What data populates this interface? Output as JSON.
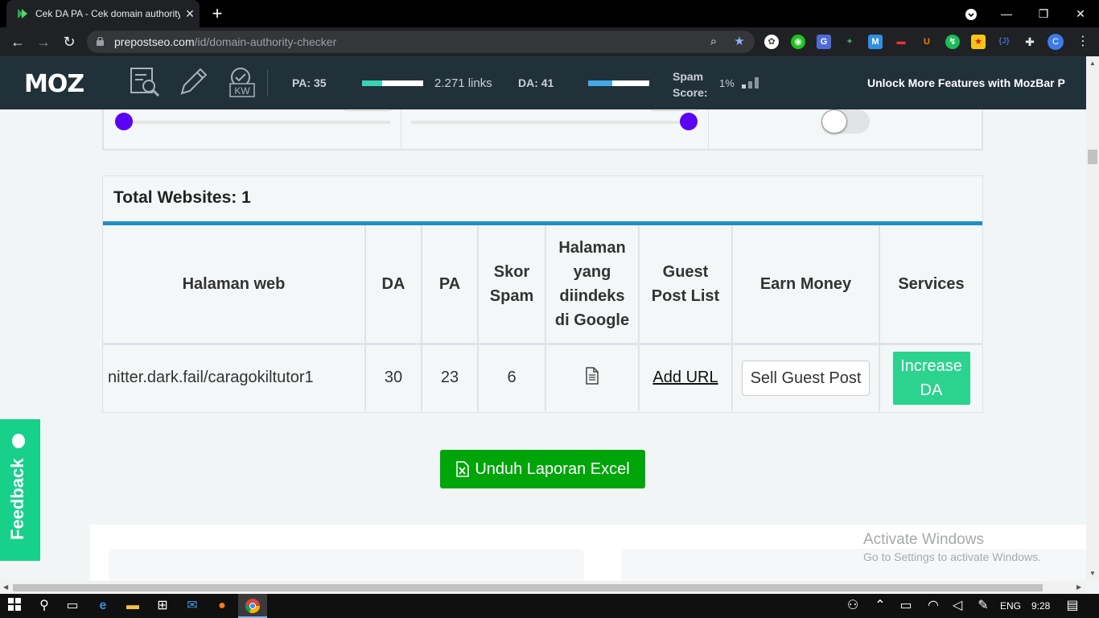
{
  "browser": {
    "tab_title": "Cek DA PA - Cek domain authority",
    "url_domain": "prepostseo.com",
    "url_path": "/id/domain-authority-checker",
    "profile_initial": "C"
  },
  "mozbar": {
    "logo": "MOZ",
    "kw_label": "KW",
    "pa_label": "PA: 35",
    "pa_fill": 0.33,
    "links_label": "2.271 links",
    "da_label": "DA: 41",
    "da_fill": 0.4,
    "spam_label_1": "Spam",
    "spam_label_2": "Score:",
    "spam_value": "1%",
    "unlock_text": "Unlock More Features with MozBar P"
  },
  "results": {
    "title": "Total Websites: 1",
    "headers": {
      "page": "Halaman web",
      "da": "DA",
      "pa": "PA",
      "spam": "Skor Spam",
      "indexed": "Halaman yang diindeks di Google",
      "guest": "Guest Post List",
      "earn": "Earn Money",
      "services": "Services"
    },
    "rows": [
      {
        "url": "nitter.dark.fail/caragokiltutor1",
        "da": "30",
        "pa": "23",
        "spam": "6",
        "guest_link": "Add URL",
        "earn_button": "Sell Guest Post",
        "services_button": "Increase DA"
      }
    ]
  },
  "excel_button": "Unduh Laporan Excel",
  "feedback_label": "Feedback",
  "watermark": {
    "line1": "Activate Windows",
    "line2": "Go to Settings to activate Windows."
  },
  "taskbar": {
    "language": "ENG",
    "time": "9:28"
  },
  "colors": {
    "mozbar_bg": "#21313a",
    "results_rule": "#1e8fc6",
    "slider_dot": "#5b00f5",
    "excel_green": "#00a50a",
    "feedback_green": "#17d08a",
    "increase_green": "#2bd38f"
  }
}
